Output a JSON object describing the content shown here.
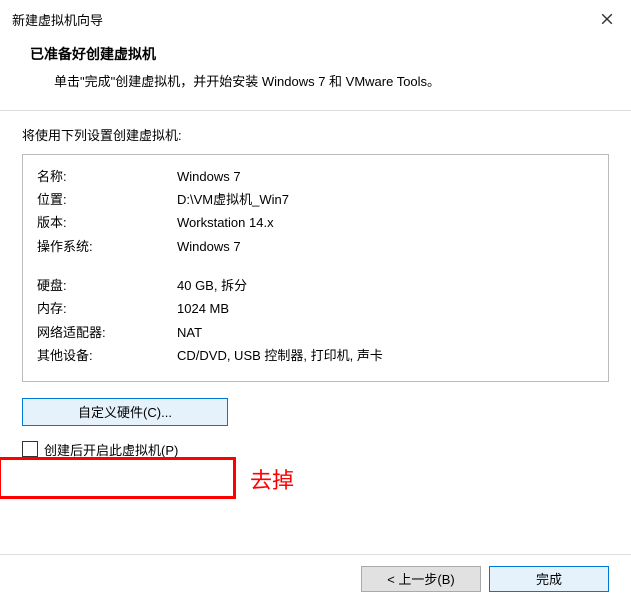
{
  "titlebar": {
    "title": "新建虚拟机向导"
  },
  "header": {
    "title": "已准备好创建虚拟机",
    "subtitle": "单击\"完成\"创建虚拟机，并开始安装 Windows 7 和 VMware Tools。"
  },
  "intro": "将使用下列设置创建虚拟机:",
  "settings": {
    "rows1": [
      {
        "label": "名称:",
        "value": "Windows 7"
      },
      {
        "label": "位置:",
        "value": "D:\\VM虚拟机_Win7"
      },
      {
        "label": "版本:",
        "value": "Workstation 14.x"
      },
      {
        "label": "操作系统:",
        "value": "Windows 7"
      }
    ],
    "rows2": [
      {
        "label": "硬盘:",
        "value": "40 GB, 拆分"
      },
      {
        "label": "内存:",
        "value": "1024 MB"
      },
      {
        "label": "网络适配器:",
        "value": "NAT"
      },
      {
        "label": "其他设备:",
        "value": "CD/DVD, USB 控制器, 打印机, 声卡"
      }
    ]
  },
  "buttons": {
    "customize": "自定义硬件(C)...",
    "back": "< 上一步(B)",
    "finish": "完成"
  },
  "checkbox": {
    "label": "创建后开启此虚拟机(P)"
  },
  "annotation": {
    "text": "去掉"
  }
}
